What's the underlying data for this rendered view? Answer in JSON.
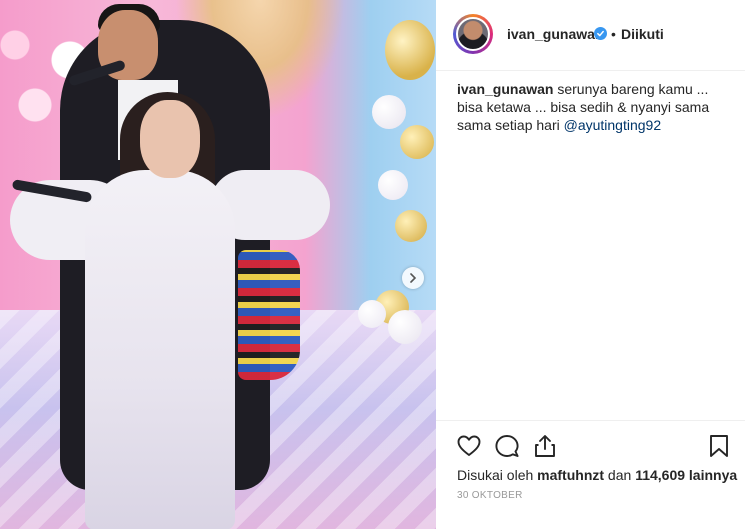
{
  "post": {
    "photo_alt": "",
    "carousel_next": "›"
  },
  "header": {
    "username": "ivan_gunawan",
    "separator": "•",
    "follow_status": "Diikuti"
  },
  "caption": {
    "username": "ivan_gunawan",
    "text": " serunya bareng kamu ... bisa ketawa ... bisa sedih & nyanyi sama sama setiap hari ",
    "mention": "@ayutingting92"
  },
  "actions": {
    "like_icon": "heart-icon",
    "comment_icon": "comment-icon",
    "share_icon": "share-icon",
    "save_icon": "bookmark-icon"
  },
  "likes": {
    "prefix": "Disukai oleh ",
    "user": "maftuhnzt",
    "middle": " dan ",
    "count": "114,609",
    "suffix": " lainnya"
  },
  "date": "30 OKTOBER",
  "colors": {
    "verified": "#3897f0",
    "mention": "#003569",
    "text": "#262626",
    "muted": "#999999"
  }
}
